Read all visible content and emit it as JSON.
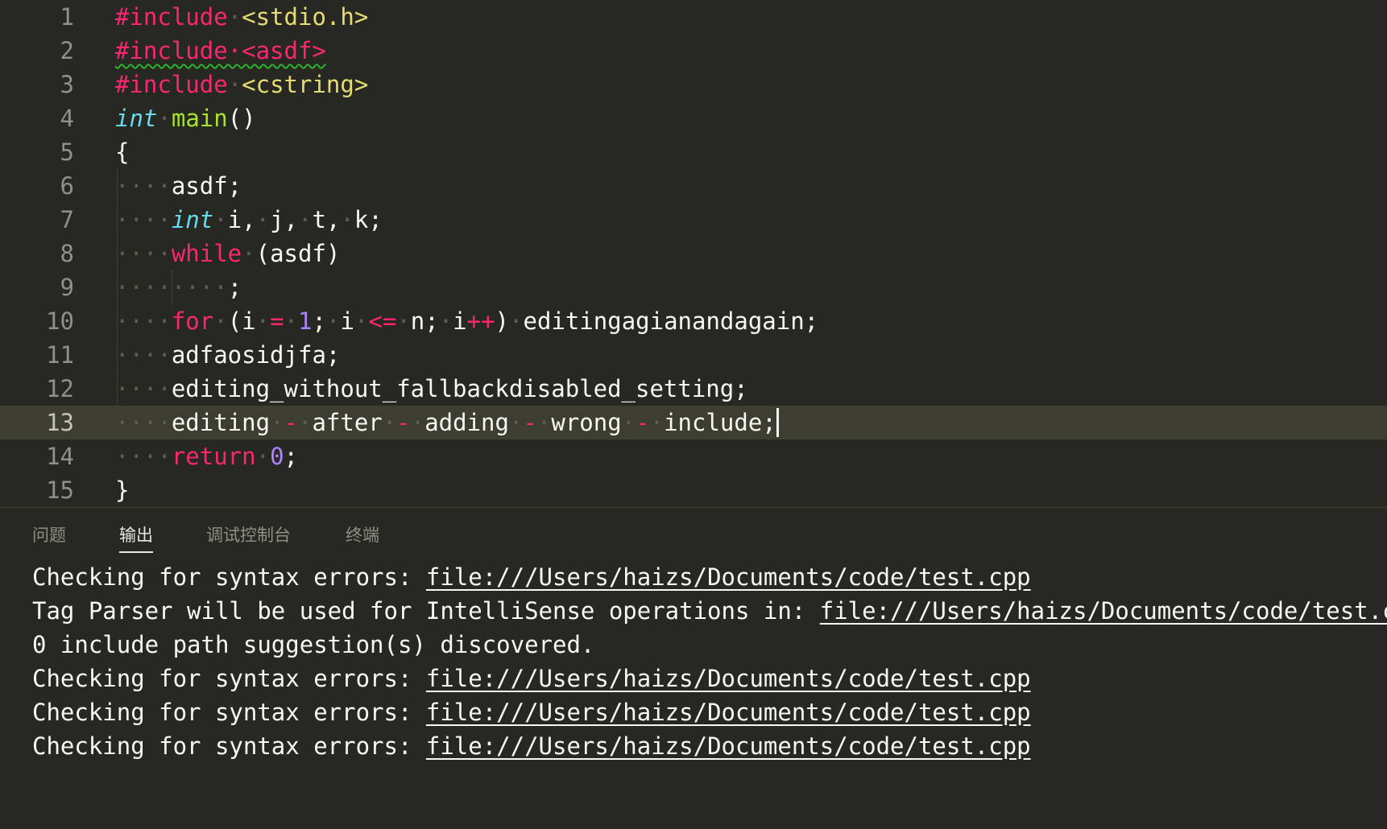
{
  "editor": {
    "lines": [
      {
        "n": "1",
        "parts": [
          [
            "kw-pre",
            "#include"
          ],
          [
            "ws",
            "·"
          ],
          [
            "str",
            "<stdio.h>"
          ]
        ]
      },
      {
        "n": "2",
        "parts": [
          [
            "kw-pre squiggle",
            "#include·<asdf>"
          ]
        ]
      },
      {
        "n": "3",
        "parts": [
          [
            "kw-pre",
            "#include"
          ],
          [
            "ws",
            "·"
          ],
          [
            "str",
            "<cstring>"
          ]
        ]
      },
      {
        "n": "4",
        "parts": [
          [
            "type",
            "int"
          ],
          [
            "ws",
            "·"
          ],
          [
            "fn",
            "main"
          ],
          [
            "",
            "()"
          ]
        ]
      },
      {
        "n": "5",
        "parts": [
          [
            "",
            "{"
          ]
        ]
      },
      {
        "n": "6",
        "parts": [
          [
            "ws",
            "····"
          ],
          [
            "",
            "asdf;"
          ]
        ]
      },
      {
        "n": "7",
        "parts": [
          [
            "ws",
            "····"
          ],
          [
            "type",
            "int"
          ],
          [
            "ws",
            "·"
          ],
          [
            "",
            "i,"
          ],
          [
            "ws",
            "·"
          ],
          [
            "",
            "j,"
          ],
          [
            "ws",
            "·"
          ],
          [
            "",
            "t,"
          ],
          [
            "ws",
            "·"
          ],
          [
            "",
            "k;"
          ]
        ]
      },
      {
        "n": "8",
        "parts": [
          [
            "ws",
            "····"
          ],
          [
            "kw",
            "while"
          ],
          [
            "ws",
            "·"
          ],
          [
            "",
            "(asdf)"
          ]
        ]
      },
      {
        "n": "9",
        "parts": [
          [
            "ws",
            "········"
          ],
          [
            "",
            ";"
          ]
        ]
      },
      {
        "n": "10",
        "parts": [
          [
            "ws",
            "····"
          ],
          [
            "kw",
            "for"
          ],
          [
            "ws",
            "·"
          ],
          [
            "",
            "(i"
          ],
          [
            "ws",
            "·"
          ],
          [
            "op",
            "="
          ],
          [
            "ws",
            "·"
          ],
          [
            "num",
            "1"
          ],
          [
            "",
            ";"
          ],
          [
            "ws",
            "·"
          ],
          [
            "",
            "i"
          ],
          [
            "ws",
            "·"
          ],
          [
            "op",
            "<="
          ],
          [
            "ws",
            "·"
          ],
          [
            "",
            "n;"
          ],
          [
            "ws",
            "·"
          ],
          [
            "",
            "i"
          ],
          [
            "op",
            "++"
          ],
          [
            "",
            ")"
          ],
          [
            "ws",
            "·"
          ],
          [
            "",
            "editingagianandagain;"
          ]
        ]
      },
      {
        "n": "11",
        "parts": [
          [
            "ws",
            "····"
          ],
          [
            "",
            "adfaosidjfa;"
          ]
        ]
      },
      {
        "n": "12",
        "parts": [
          [
            "ws",
            "····"
          ],
          [
            "",
            "editing_without_fallbackdisabled_setting;"
          ]
        ]
      },
      {
        "n": "13",
        "parts": [
          [
            "ws",
            "····"
          ],
          [
            "",
            "editing"
          ],
          [
            "ws",
            "·"
          ],
          [
            "op",
            "-"
          ],
          [
            "ws",
            "·"
          ],
          [
            "",
            "after"
          ],
          [
            "ws",
            "·"
          ],
          [
            "op",
            "-"
          ],
          [
            "ws",
            "·"
          ],
          [
            "",
            "adding"
          ],
          [
            "ws",
            "·"
          ],
          [
            "op",
            "-"
          ],
          [
            "ws",
            "·"
          ],
          [
            "",
            "wrong"
          ],
          [
            "ws",
            "·"
          ],
          [
            "op",
            "-"
          ],
          [
            "ws",
            "·"
          ],
          [
            "",
            "include;"
          ]
        ],
        "current": true
      },
      {
        "n": "14",
        "parts": [
          [
            "ws",
            "····"
          ],
          [
            "kw",
            "return"
          ],
          [
            "ws",
            "·"
          ],
          [
            "num",
            "0"
          ],
          [
            "",
            ";"
          ]
        ]
      },
      {
        "n": "15",
        "parts": [
          [
            "",
            "}"
          ]
        ]
      }
    ]
  },
  "panel": {
    "tabs": [
      "问题",
      "输出",
      "调试控制台",
      "终端"
    ],
    "active_tab": "输出",
    "output": [
      {
        "text": "Checking for syntax errors: ",
        "link": "file:///Users/haizs/Documents/code/test.cpp"
      },
      {
        "text": "Tag Parser will be used for IntelliSense operations in: ",
        "link": "file:///Users/haizs/Documents/code/test.cpp"
      },
      {
        "text": "0 include path suggestion(s) discovered.",
        "link": ""
      },
      {
        "text": "Checking for syntax errors: ",
        "link": "file:///Users/haizs/Documents/code/test.cpp"
      },
      {
        "text": "Checking for syntax errors: ",
        "link": "file:///Users/haizs/Documents/code/test.cpp"
      },
      {
        "text": "Checking for syntax errors: ",
        "link": "file:///Users/haizs/Documents/code/test.cpp"
      }
    ]
  },
  "colors": {
    "background": "#272822",
    "current_line": "#3e3d32",
    "keyword": "#f92672",
    "string": "#e6db74",
    "type": "#66d9ef",
    "function": "#a6e22e",
    "number": "#ae81ff"
  }
}
